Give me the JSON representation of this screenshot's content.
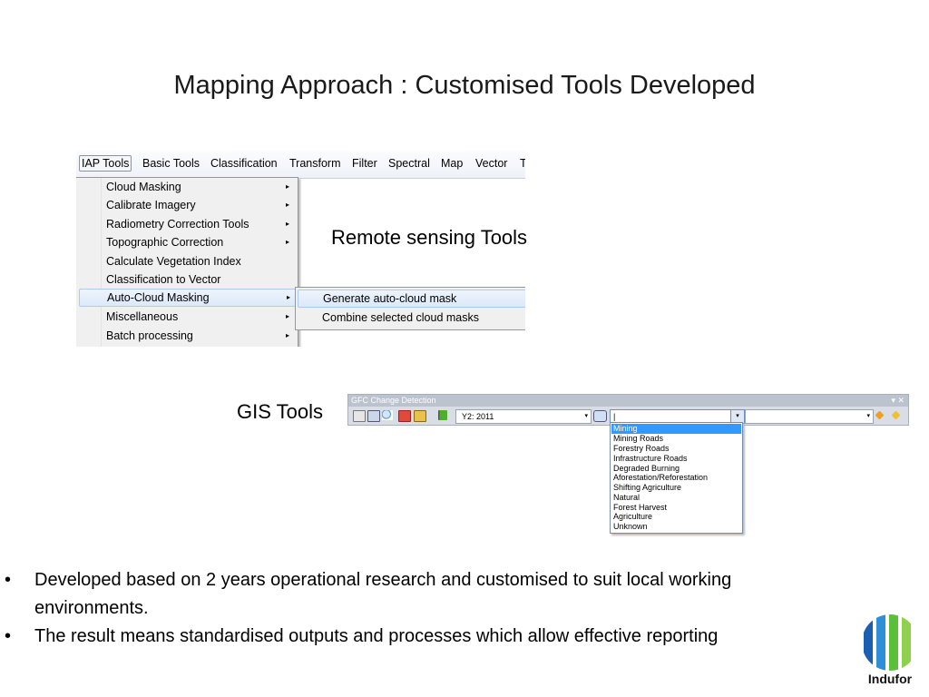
{
  "slide": {
    "title": "Mapping Approach : Customised Tools Developed",
    "caption_remote": "Remote sensing Tools",
    "caption_gis": "GIS Tools"
  },
  "menu_bar": {
    "items": [
      "IAP Tools",
      "Basic Tools",
      "Classification",
      "Transform",
      "Filter",
      "Spectral",
      "Map",
      "Vector",
      "T"
    ]
  },
  "dropdown": {
    "items": [
      {
        "label": "Cloud Masking",
        "has_submenu": true
      },
      {
        "label": "Calibrate Imagery",
        "has_submenu": true
      },
      {
        "label": "Radiometry Correction Tools",
        "has_submenu": true
      },
      {
        "label": "Topographic Correction",
        "has_submenu": true
      },
      {
        "label": "Calculate Vegetation Index",
        "has_submenu": false
      },
      {
        "label": "Classification to Vector",
        "has_submenu": false
      },
      {
        "label": "Auto-Cloud Masking",
        "has_submenu": true
      },
      {
        "label": "Miscellaneous",
        "has_submenu": true
      },
      {
        "label": "Batch processing",
        "has_submenu": true
      }
    ],
    "arrow": "▸"
  },
  "submenu": {
    "items": [
      "Generate auto-cloud mask",
      "Combine selected cloud masks"
    ]
  },
  "gfc_toolbar": {
    "title": "GFC Change Detection",
    "window_controls": "▾ ✕",
    "year_value": "Y2: 2011",
    "dropdown_arrow": "▾"
  },
  "listbox": {
    "items": [
      "Mining",
      "Mining Roads",
      "Forestry Roads",
      "Infrastructure Roads",
      "Degraded Burning",
      "Aforestation/Reforestation",
      "Shifting Agriculture",
      "Natural",
      "Forest Harvest",
      "Agriculture",
      "Unknown"
    ],
    "selected": "Mining"
  },
  "bullets": {
    "marker": "•",
    "b1_line1": "Developed based on 2 years operational research and customised to suit local working",
    "b1_line2": "environments.",
    "b2": "The result means standardised outputs and processes which allow effective reporting"
  },
  "logo": {
    "name": "Indufor",
    "colors": [
      "#1b5fb3",
      "#2e8fd8",
      "#5cbf3a",
      "#8fd14f"
    ]
  }
}
